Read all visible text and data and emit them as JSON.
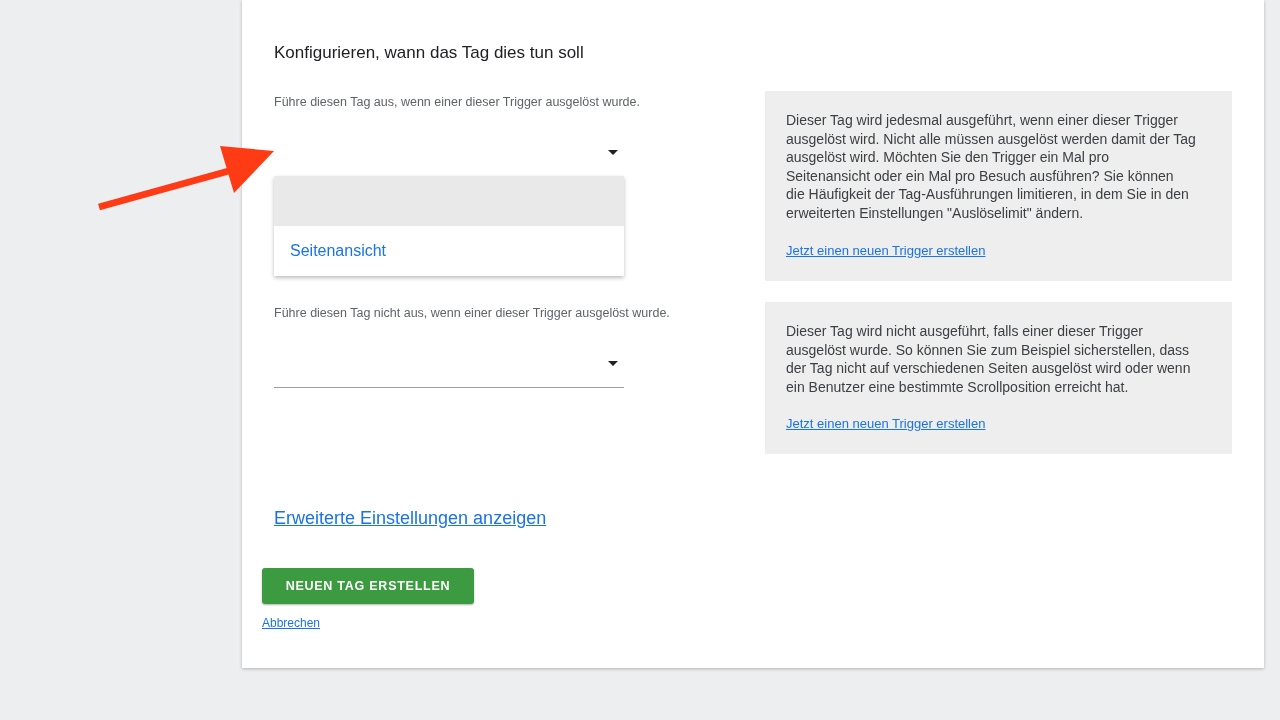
{
  "section_title": "Konfigurieren, wann das Tag dies tun soll",
  "trigger_groups": [
    {
      "label": "Führe diesen Tag aus, wenn einer dieser Trigger ausgelöst wurde.",
      "dropdown": {
        "open": true,
        "options": [
          {
            "label": "Seitenansicht",
            "selected": false
          }
        ]
      },
      "help_text": "Dieser Tag wird jedesmal ausgeführt, wenn einer dieser Trigger ausgelöst wird. Nicht alle müssen ausgelöst werden damit der Tag ausgelöst wird. Möchten Sie den Trigger ein Mal pro Seitenansicht oder ein Mal pro Besuch ausführen? Sie können die Häufigkeit der Tag-Ausführungen limitieren, in dem Sie in den erweiterten Einstellungen \"Auslöselimit\" ändern.",
      "help_link": "Jetzt einen neuen Trigger erstellen"
    },
    {
      "label": "Führe diesen Tag nicht aus, wenn einer dieser Trigger ausgelöst wurde.",
      "dropdown": {
        "open": false
      },
      "help_text": "Dieser Tag wird nicht ausgeführt, falls einer dieser Trigger ausgelöst wurde. So können Sie zum Beispiel sicherstellen, dass der Tag nicht auf verschiedenen Seiten ausgelöst wird oder wenn ein Benutzer eine bestimmte Scrollposition erreicht hat.",
      "help_link": "Jetzt einen neuen Trigger erstellen"
    }
  ],
  "advanced_link": "Erweiterte Einstellungen anzeigen",
  "primary_button": "NEUEN TAG ERSTELLEN",
  "cancel_link": "Abbrechen"
}
